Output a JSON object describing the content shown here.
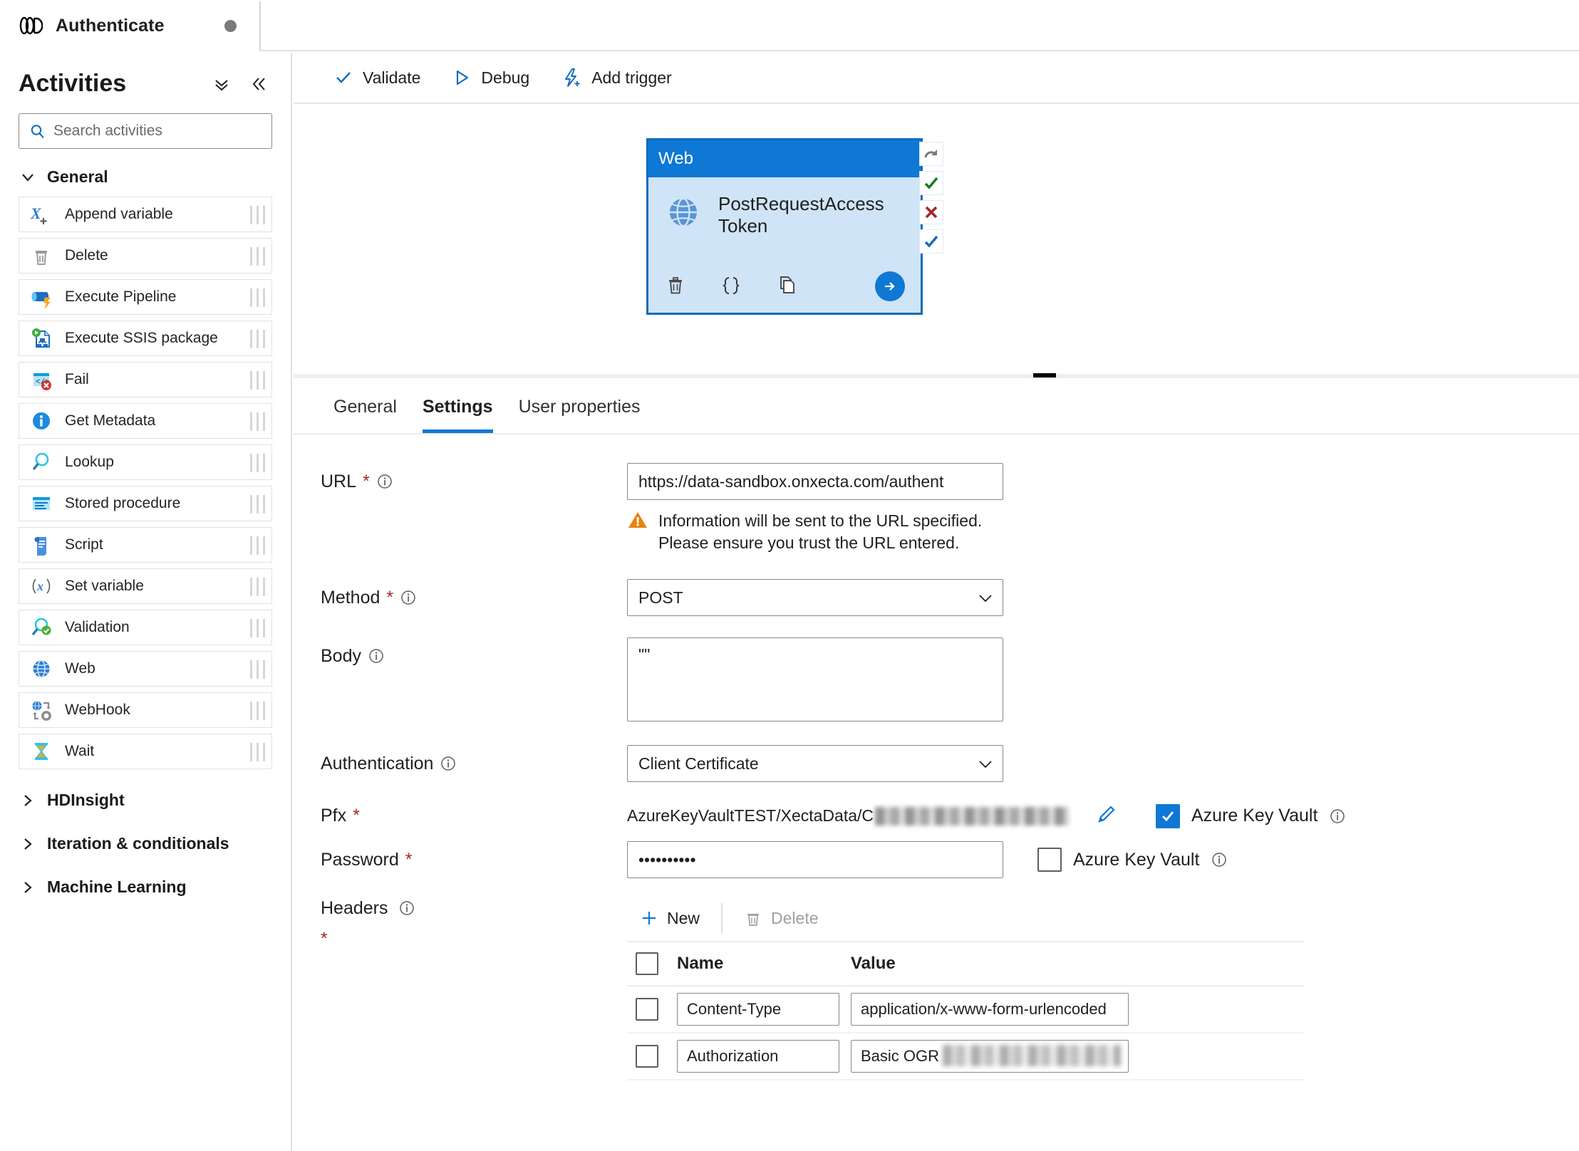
{
  "tab": {
    "title": "Authenticate",
    "icon": "pipeline-icon",
    "modified_dot": "●"
  },
  "sidebar": {
    "title": "Activities",
    "search": {
      "placeholder": "Search activities",
      "value": "",
      "icon": "search-icon"
    },
    "collapse_all_icon": "chevron-double-down-icon",
    "collapse_pane_icon": "chevron-double-left-icon",
    "groups": [
      {
        "label": "General",
        "expanded": true
      },
      {
        "label": "HDInsight",
        "expanded": false
      },
      {
        "label": "Iteration & conditionals",
        "expanded": false
      },
      {
        "label": "Machine Learning",
        "expanded": false
      }
    ],
    "activities": [
      {
        "label": "Append variable",
        "icon": "append-variable-icon"
      },
      {
        "label": "Delete",
        "icon": "trash-icon"
      },
      {
        "label": "Execute Pipeline",
        "icon": "execute-pipeline-icon"
      },
      {
        "label": "Execute SSIS package",
        "icon": "ssis-package-icon"
      },
      {
        "label": "Fail",
        "icon": "fail-icon"
      },
      {
        "label": "Get Metadata",
        "icon": "info-circle-icon"
      },
      {
        "label": "Lookup",
        "icon": "magnifier-icon"
      },
      {
        "label": "Stored procedure",
        "icon": "stored-procedure-icon"
      },
      {
        "label": "Script",
        "icon": "script-scroll-icon"
      },
      {
        "label": "Set variable",
        "icon": "set-variable-icon"
      },
      {
        "label": "Validation",
        "icon": "validation-icon"
      },
      {
        "label": "Web",
        "icon": "globe-icon"
      },
      {
        "label": "WebHook",
        "icon": "webhook-icon"
      },
      {
        "label": "Wait",
        "icon": "hourglass-icon"
      }
    ]
  },
  "toolbar": {
    "validate": "Validate",
    "debug": "Debug",
    "add_trigger": "Add trigger",
    "validate_icon": "checkmark-icon",
    "debug_icon": "play-triangle-icon",
    "trigger_icon": "lightning-plus-icon"
  },
  "canvas": {
    "node": {
      "type_label": "Web",
      "name": "PostRequestAccess Token",
      "icon": "globe-icon",
      "actions": [
        {
          "name": "delete-icon"
        },
        {
          "name": "code-braces-icon"
        },
        {
          "name": "clone-icon"
        }
      ],
      "arrow_icon": "arrow-right-icon"
    },
    "dependency_handles": [
      {
        "name": "on-skip-handle",
        "icon": "skip-arrow-icon"
      },
      {
        "name": "on-success-handle",
        "icon": "green-check-icon"
      },
      {
        "name": "on-failure-handle",
        "icon": "red-x-icon"
      },
      {
        "name": "on-completion-handle",
        "icon": "blue-check-icon"
      }
    ],
    "annotation_circle": {
      "name": "red-circle-annotation",
      "color": "#e81123"
    }
  },
  "properties": {
    "tabs": [
      {
        "label": "General",
        "active": false
      },
      {
        "label": "Settings",
        "active": true
      },
      {
        "label": "User properties",
        "active": false
      }
    ],
    "accent": "#0f78d4",
    "fields": {
      "url": {
        "label": "URL",
        "required": true,
        "value": "https://data-sandbox.onxecta.com/authent",
        "warning": "Information will be sent to the URL specified. Please ensure you trust the URL entered.",
        "warning_icon": "warning-triangle-icon"
      },
      "method": {
        "label": "Method",
        "required": true,
        "value": "POST"
      },
      "body": {
        "label": "Body",
        "required": false,
        "value": "\"\""
      },
      "authentication": {
        "label": "Authentication",
        "required": false,
        "value": "Client Certificate"
      },
      "pfx": {
        "label": "Pfx",
        "required": true,
        "value": "AzureKeyVaultTEST/XectaData/C",
        "redacted": true,
        "edit_icon": "pencil-icon",
        "akv_label": "Azure Key Vault",
        "akv_checked": true
      },
      "password": {
        "label": "Password",
        "required": true,
        "value": "••••••••••",
        "akv_label": "Azure Key Vault",
        "akv_checked": false
      },
      "headers": {
        "label": "Headers",
        "required": true,
        "new_label": "New",
        "delete_label": "Delete",
        "new_icon": "plus-icon",
        "delete_icon": "trash-icon",
        "columns": [
          "Name",
          "Value"
        ],
        "rows": [
          {
            "name": "Content-Type",
            "value": "application/x-www-form-urlencoded",
            "redacted": false,
            "checked": false
          },
          {
            "name": "Authorization",
            "value": "Basic OGR",
            "redacted": true,
            "checked": false
          }
        ]
      }
    }
  }
}
